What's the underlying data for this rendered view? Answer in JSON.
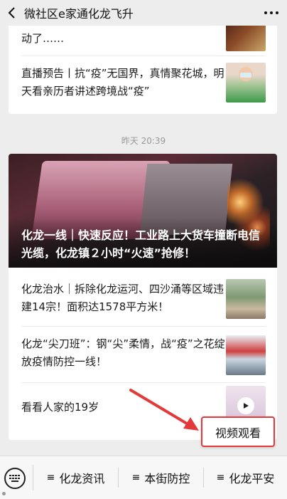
{
  "nav": {
    "title": "微社区e家通化龙飞升",
    "back_icon": "chevron-left-icon",
    "more_icon": "more-dots-icon"
  },
  "feed_top": {
    "continued_text": "动了……",
    "items": [
      {
        "title": "直播预告丨抗“疫”无国界，真情聚花城，明天看亲历者讲述跨境战“疫”"
      }
    ]
  },
  "timestamp": "昨天 20:39",
  "feed_main": {
    "hero_title": "化龙一线｜快速反应！工业路上大货车撞断电信光缆，化龙镇２小时“火速”抢修！",
    "items": [
      {
        "title": "化龙治水｜拆除化龙运河、四沙涌等区域违建14宗！面积达1578平方米！"
      },
      {
        "title": "化龙“尖刀班”：钢“尖”柔情，战“疫”之花绽放疫情防控一线！"
      },
      {
        "title": "看看人家的19岁"
      }
    ]
  },
  "annotation": {
    "popup_label": "视频观看",
    "arrow_color": "#e23a3a"
  },
  "bottom_menu": {
    "keyboard_icon": "keyboard-icon",
    "items": [
      {
        "label": "化龙资讯"
      },
      {
        "label": "本街防控"
      },
      {
        "label": "化龙平安"
      }
    ]
  },
  "colors": {
    "accent_red": "#e23a3a",
    "background": "#ededed"
  }
}
